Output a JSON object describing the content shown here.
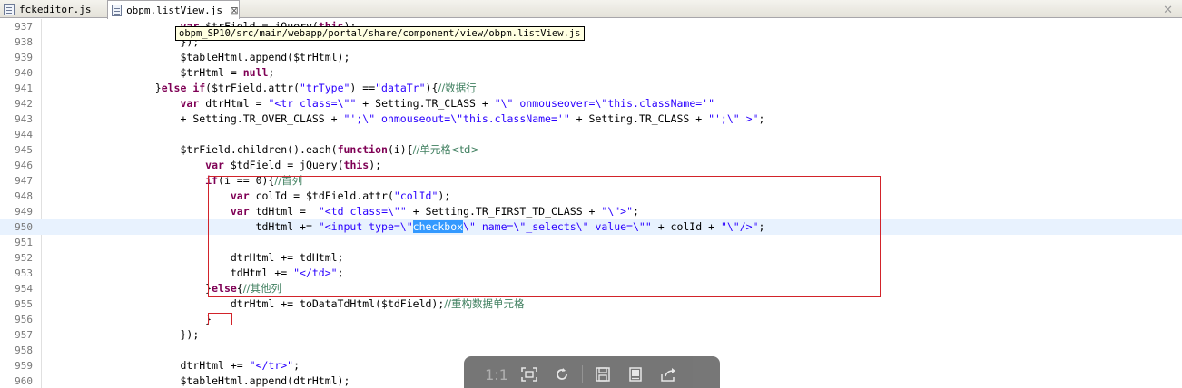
{
  "tabs": [
    {
      "label": "fckeditor.js",
      "active": false
    },
    {
      "label": "obpm.listView.js",
      "active": true,
      "close": "⊠"
    }
  ],
  "view_close": "✕",
  "tooltip": "obpm_SP10/src/main/webapp/portal/share/component/view/obpm.listView.js",
  "lines": [
    {
      "n": "937",
      "html": "                    <span class=\"kw\">var</span> $trField = jQuery(<span class=\"kw\">this</span>);"
    },
    {
      "n": "938",
      "html": "                    });"
    },
    {
      "n": "939",
      "html": "                    $tableHtml.append($trHtml);"
    },
    {
      "n": "940",
      "html": "                    $trHtml = <span class=\"kw\">null</span>;"
    },
    {
      "n": "941",
      "html": "                }<span class=\"kw\">else if</span>($trField.attr(<span class=\"str\">\"trType\"</span>) ==<span class=\"str\">\"dataTr\"</span>){<span class=\"cmt\">//数据行</span>"
    },
    {
      "n": "942",
      "html": "                    <span class=\"kw\">var</span> dtrHtml = <span class=\"str\">\"&lt;tr class=\\\"\"</span> + Setting.TR_CLASS + <span class=\"str\">\"\\\" onmouseover=\\\"this.className='\"</span>"
    },
    {
      "n": "943",
      "html": "                    + Setting.TR_OVER_CLASS + <span class=\"str\">\"';\\\" onmouseout=\\\"this.className='\"</span> + Setting.TR_CLASS + <span class=\"str\">\"';\\\" &gt;\"</span>;"
    },
    {
      "n": "944",
      "html": ""
    },
    {
      "n": "945",
      "html": "                    $trField.children().each(<span class=\"kw\">function</span>(i){<span class=\"cmt\">//单元格&lt;td&gt;</span>"
    },
    {
      "n": "946",
      "html": "                        <span class=\"kw\">var</span> $tdField = jQuery(<span class=\"kw\">this</span>);"
    },
    {
      "n": "947",
      "html": "                        <span class=\"kw\">if</span>(i == 0){<span class=\"cmt\">//首列</span>"
    },
    {
      "n": "948",
      "html": "                            <span class=\"kw\">var</span> colId = $tdField.attr(<span class=\"str\">\"colId\"</span>);"
    },
    {
      "n": "949",
      "html": "                            <span class=\"kw\">var</span> tdHtml =  <span class=\"str\">\"&lt;td class=\\\"\"</span> + Setting.TR_FIRST_TD_CLASS + <span class=\"str\">\"\\\"&gt;\"</span>;"
    },
    {
      "n": "950",
      "html": "                                tdHtml += <span class=\"str\">\"&lt;input type=\\\"<span class=\"sel\">checkbox</span>\\\" name=\\\"_selects\\\" value=\\\"\"</span> + colId + <span class=\"str\">\"\\\"/&gt;\"</span>;",
      "current": true
    },
    {
      "n": "951",
      "html": ""
    },
    {
      "n": "952",
      "html": "                            dtrHtml += tdHtml;"
    },
    {
      "n": "953",
      "html": "                            tdHtml += <span class=\"str\">\"&lt;/td&gt;\"</span>;"
    },
    {
      "n": "954",
      "html": "                        }<span class=\"kw\">else</span>{<span class=\"cmt\">//其他列</span>"
    },
    {
      "n": "955",
      "html": "                            dtrHtml += toDataTdHtml($tdField);<span class=\"cmt\">//重构数据单元格</span>"
    },
    {
      "n": "956",
      "html": "                        }"
    },
    {
      "n": "957",
      "html": "                    });"
    },
    {
      "n": "958",
      "html": ""
    },
    {
      "n": "959",
      "html": "                    dtrHtml += <span class=\"str\">\"&lt;/tr&gt;\"</span>;"
    },
    {
      "n": "960",
      "html": "                    $tableHtml.append(dtrHtml);"
    }
  ],
  "viewer_toolbar": {
    "actual_size": "1:1",
    "fit_icon": "fit-screen-icon",
    "rotate_icon": "rotate-icon",
    "save_icon": "save-icon",
    "ppt_icon": "slideshow-icon",
    "share_icon": "share-icon"
  }
}
